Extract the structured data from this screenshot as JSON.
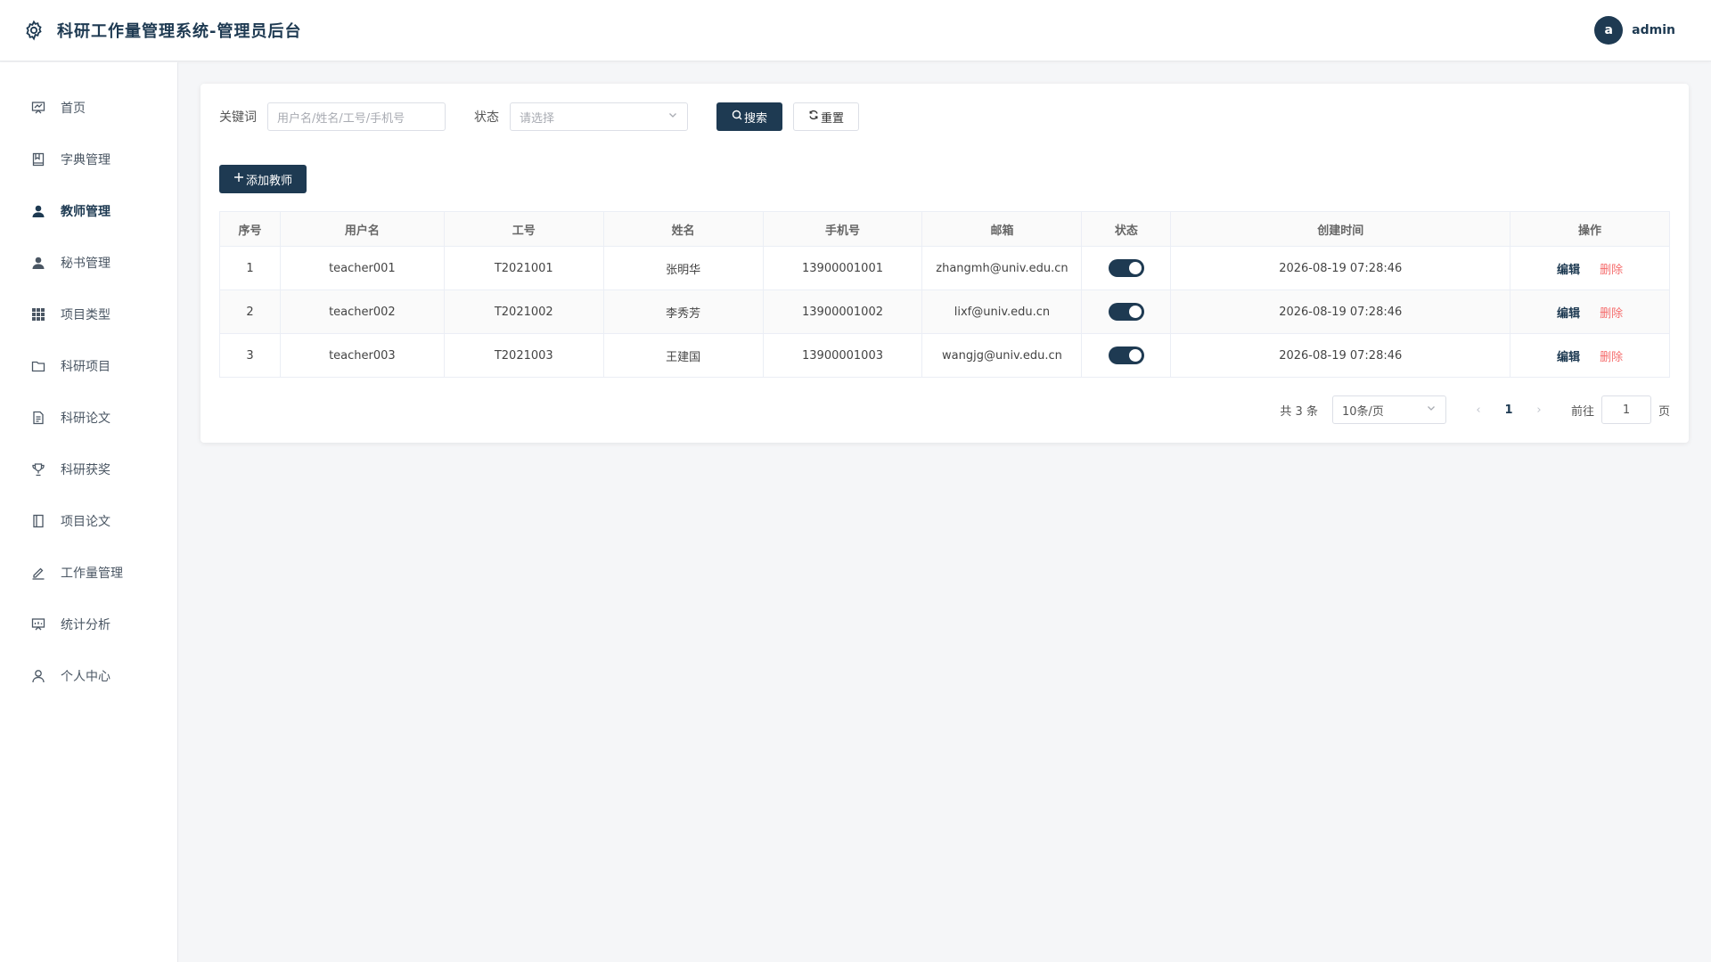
{
  "header": {
    "title": "科研工作量管理系统-管理员后台",
    "avatar_letter": "a",
    "username": "admin"
  },
  "sidebar": {
    "items": [
      {
        "label": "首页",
        "icon": "dashboard-icon"
      },
      {
        "label": "字典管理",
        "icon": "book-icon"
      },
      {
        "label": "教师管理",
        "icon": "user-filled-icon",
        "active": true
      },
      {
        "label": "秘书管理",
        "icon": "user-filled-icon"
      },
      {
        "label": "项目类型",
        "icon": "grid-icon"
      },
      {
        "label": "科研项目",
        "icon": "folder-icon"
      },
      {
        "label": "科研论文",
        "icon": "document-icon"
      },
      {
        "label": "科研获奖",
        "icon": "trophy-icon"
      },
      {
        "label": "项目论文",
        "icon": "notebook-icon"
      },
      {
        "label": "工作量管理",
        "icon": "edit-pen-icon"
      },
      {
        "label": "统计分析",
        "icon": "presentation-icon"
      },
      {
        "label": "个人中心",
        "icon": "user-icon"
      }
    ]
  },
  "search": {
    "keyword_label": "关键词",
    "keyword_placeholder": "用户名/姓名/工号/手机号",
    "status_label": "状态",
    "status_placeholder": "请选择",
    "search_button": "搜索",
    "reset_button": "重置"
  },
  "add_button": "添加教师",
  "table": {
    "columns": [
      "序号",
      "用户名",
      "工号",
      "姓名",
      "手机号",
      "邮箱",
      "状态",
      "创建时间",
      "操作"
    ],
    "rows": [
      {
        "no": "1",
        "username": "teacher001",
        "job_no": "T2021001",
        "name": "张明华",
        "phone": "13900001001",
        "email": "zhangmh@univ.edu.cn",
        "enabled": true,
        "created": "2026-08-19 07:28:46"
      },
      {
        "no": "2",
        "username": "teacher002",
        "job_no": "T2021002",
        "name": "李秀芳",
        "phone": "13900001002",
        "email": "lixf@univ.edu.cn",
        "enabled": true,
        "created": "2026-08-19 07:28:46"
      },
      {
        "no": "3",
        "username": "teacher003",
        "job_no": "T2021003",
        "name": "王建国",
        "phone": "13900001003",
        "email": "wangjg@univ.edu.cn",
        "enabled": true,
        "created": "2026-08-19 07:28:46"
      }
    ],
    "edit_label": "编辑",
    "delete_label": "删除"
  },
  "pagination": {
    "total_text": "共 3 条",
    "page_size": "10条/页",
    "current_page": "1",
    "goto_label": "前往",
    "goto_value": "1",
    "page_suffix": "页"
  },
  "colors": {
    "primary": "#1e3a52",
    "danger": "#f56c6c"
  }
}
